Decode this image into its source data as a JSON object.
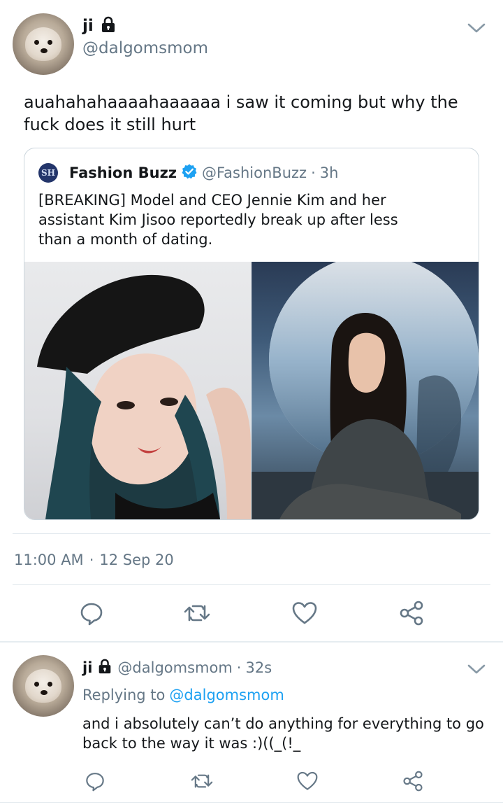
{
  "main_tweet": {
    "display_name": "ji",
    "handle": "@dalgomsmom",
    "text": "auahahahaaaahaaaaaa i saw it coming but why the fuck does it still hurt",
    "timestamp": "11:00 AM",
    "date_sep": "·",
    "date": "12 Sep 20",
    "icons": [
      "lock-icon",
      "chevron-down-icon"
    ]
  },
  "quoted_tweet": {
    "display_name": "Fashion Buzz",
    "handle": "@FashionBuzz",
    "sep": "·",
    "age": "3h",
    "text": "[BREAKING] Model and CEO Jennie Kim and her assistant Kim Jisoo reportedly break up after less than a month of dating.",
    "avatar_text": "SH",
    "verified_color": "#1da1f2"
  },
  "actions": {
    "icons": [
      "reply-icon",
      "retweet-icon",
      "like-icon",
      "share-icon"
    ],
    "color": "#657786"
  },
  "reply_tweet": {
    "display_name": "ji",
    "handle": "@dalgomsmom",
    "sep": "·",
    "age": "32s",
    "replying_label": "Replying to",
    "replying_to": "@dalgomsmom",
    "text": "and i absolutely can’t do anything for everything to go back to the way it was :)((_(!_"
  },
  "colors": {
    "text": "#14171a",
    "secondary": "#657786",
    "link": "#1da1f2",
    "border": "#e1e8ed"
  }
}
